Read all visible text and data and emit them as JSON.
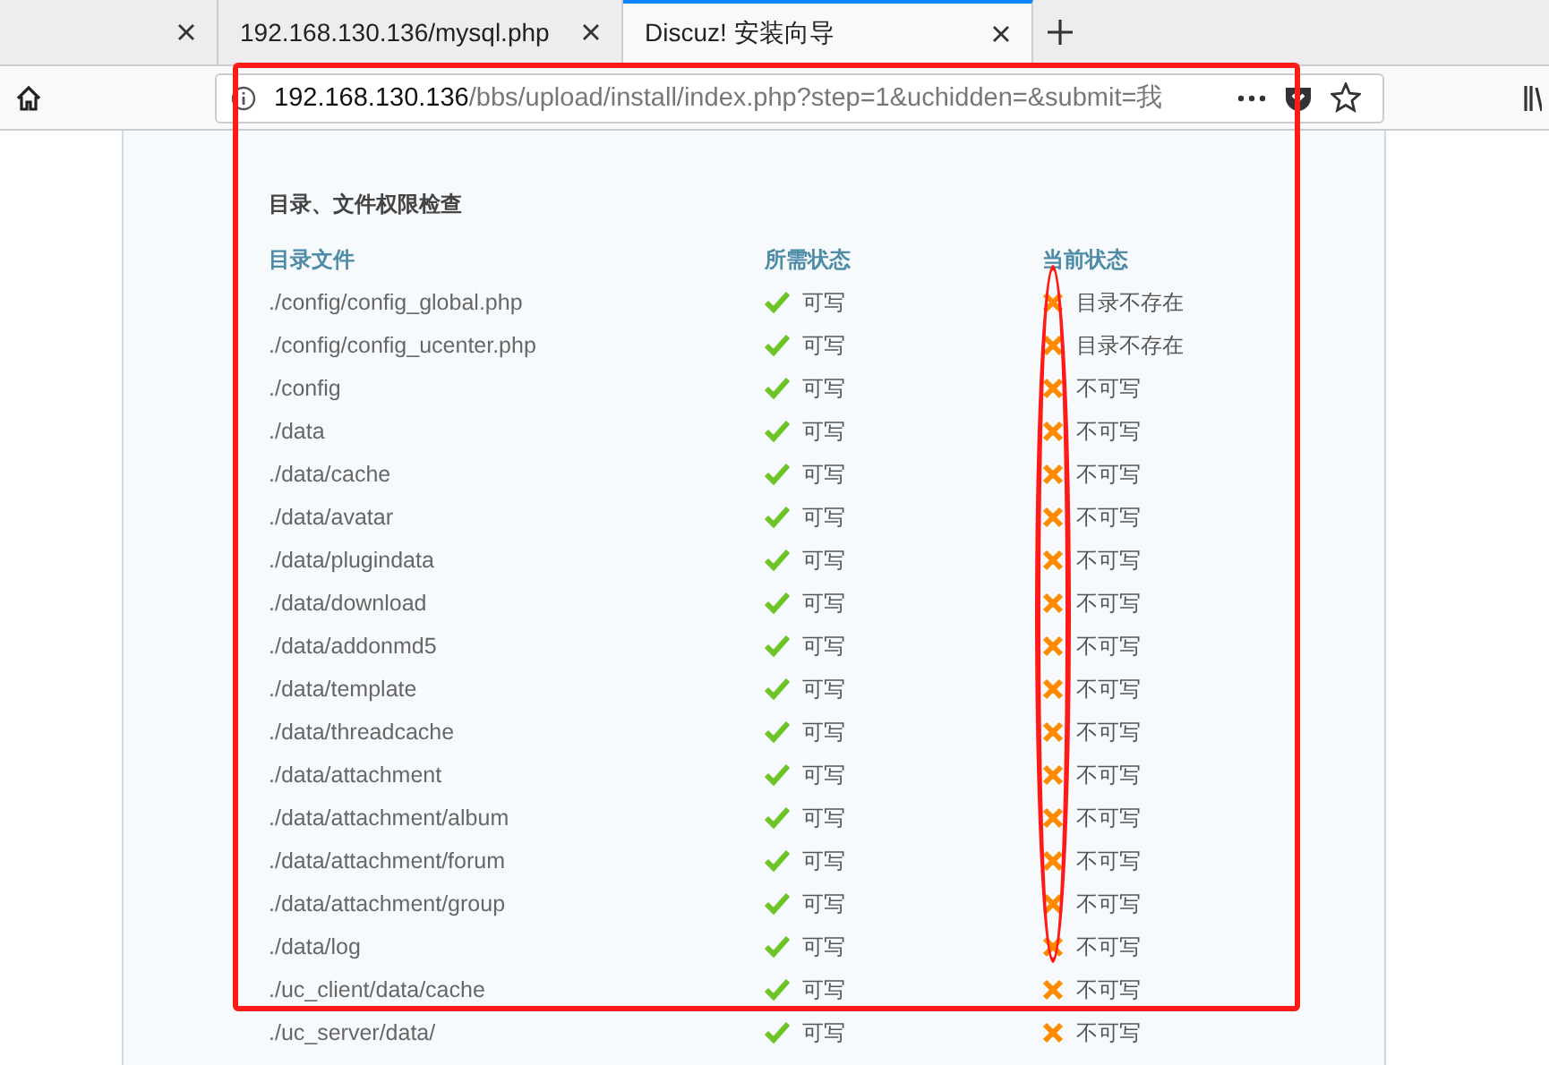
{
  "tabs": [
    {
      "selected": false
    },
    {
      "title": "192.168.130.136/mysql.php",
      "selected": false
    },
    {
      "title": "Discuz! 安装向导",
      "selected": true
    }
  ],
  "address_bar": {
    "host": "192.168.130.136",
    "path": "/bbs/upload/install/index.php?step=1&uchidden=&submit=我"
  },
  "section": {
    "title": "目录、文件权限检查",
    "columns": [
      "目录文件",
      "所需状态",
      "当前状态"
    ],
    "rows": [
      {
        "path": "./config/config_global.php",
        "required": {
          "ok": true,
          "text": "可写"
        },
        "current": {
          "ok": false,
          "text": "目录不存在"
        }
      },
      {
        "path": "./config/config_ucenter.php",
        "required": {
          "ok": true,
          "text": "可写"
        },
        "current": {
          "ok": false,
          "text": "目录不存在"
        }
      },
      {
        "path": "./config",
        "required": {
          "ok": true,
          "text": "可写"
        },
        "current": {
          "ok": false,
          "text": "不可写"
        }
      },
      {
        "path": "./data",
        "required": {
          "ok": true,
          "text": "可写"
        },
        "current": {
          "ok": false,
          "text": "不可写"
        }
      },
      {
        "path": "./data/cache",
        "required": {
          "ok": true,
          "text": "可写"
        },
        "current": {
          "ok": false,
          "text": "不可写"
        }
      },
      {
        "path": "./data/avatar",
        "required": {
          "ok": true,
          "text": "可写"
        },
        "current": {
          "ok": false,
          "text": "不可写"
        }
      },
      {
        "path": "./data/plugindata",
        "required": {
          "ok": true,
          "text": "可写"
        },
        "current": {
          "ok": false,
          "text": "不可写"
        }
      },
      {
        "path": "./data/download",
        "required": {
          "ok": true,
          "text": "可写"
        },
        "current": {
          "ok": false,
          "text": "不可写"
        }
      },
      {
        "path": "./data/addonmd5",
        "required": {
          "ok": true,
          "text": "可写"
        },
        "current": {
          "ok": false,
          "text": "不可写"
        }
      },
      {
        "path": "./data/template",
        "required": {
          "ok": true,
          "text": "可写"
        },
        "current": {
          "ok": false,
          "text": "不可写"
        }
      },
      {
        "path": "./data/threadcache",
        "required": {
          "ok": true,
          "text": "可写"
        },
        "current": {
          "ok": false,
          "text": "不可写"
        }
      },
      {
        "path": "./data/attachment",
        "required": {
          "ok": true,
          "text": "可写"
        },
        "current": {
          "ok": false,
          "text": "不可写"
        }
      },
      {
        "path": "./data/attachment/album",
        "required": {
          "ok": true,
          "text": "可写"
        },
        "current": {
          "ok": false,
          "text": "不可写"
        }
      },
      {
        "path": "./data/attachment/forum",
        "required": {
          "ok": true,
          "text": "可写"
        },
        "current": {
          "ok": false,
          "text": "不可写"
        }
      },
      {
        "path": "./data/attachment/group",
        "required": {
          "ok": true,
          "text": "可写"
        },
        "current": {
          "ok": false,
          "text": "不可写"
        }
      },
      {
        "path": "./data/log",
        "required": {
          "ok": true,
          "text": "可写"
        },
        "current": {
          "ok": false,
          "text": "不可写"
        }
      },
      {
        "path": "./uc_client/data/cache",
        "required": {
          "ok": true,
          "text": "可写"
        },
        "current": {
          "ok": false,
          "text": "不可写"
        }
      },
      {
        "path": "./uc_server/data/",
        "required": {
          "ok": true,
          "text": "可写"
        },
        "current": {
          "ok": false,
          "text": "不可写"
        }
      }
    ]
  }
}
